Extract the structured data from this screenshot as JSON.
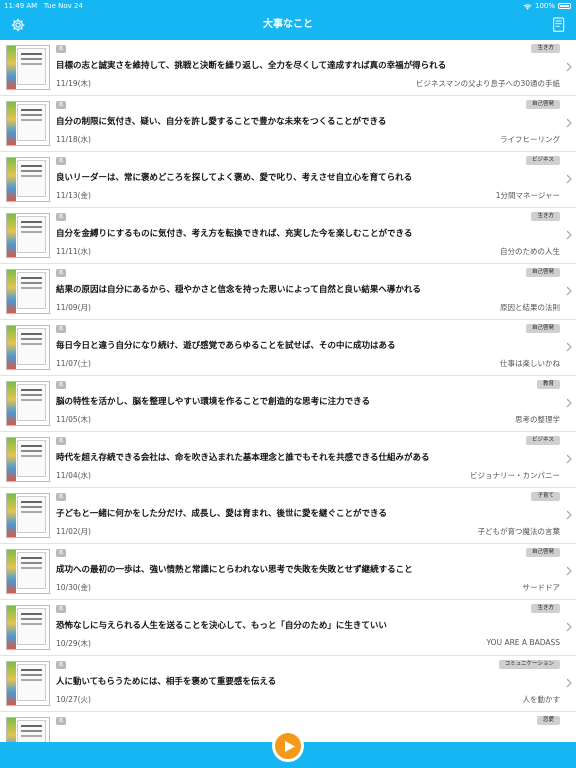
{
  "status_bar": {
    "time": "11:49 AM",
    "date": "Tue Nov 24",
    "battery": "100%"
  },
  "nav": {
    "title": "大事なこと"
  },
  "items": [
    {
      "icon": "本",
      "category": "生き方",
      "quote": "目標の志と誠実さを維持して、挑戦と決断を繰り返し、全力を尽くして達成すれば真の幸福が得られる",
      "date": "11/19(木)",
      "book": "ビジネスマンの父より息子への30通の手紙"
    },
    {
      "icon": "本",
      "category": "自己啓発",
      "quote": "自分の制限に気付き、疑い、自分を許し愛することで豊かな未来をつくることができる",
      "date": "11/18(水)",
      "book": "ライフヒーリング"
    },
    {
      "icon": "本",
      "category": "ビジネス",
      "quote": "良いリーダーは、常に褒めどころを探してよく褒め、愛で叱り、考えさせ自立心を育てられる",
      "date": "11/13(金)",
      "book": "1分間マネージャー"
    },
    {
      "icon": "本",
      "category": "生き方",
      "quote": "自分を金縛りにするものに気付き、考え方を転換できれば、充実した今を楽しむことができる",
      "date": "11/11(水)",
      "book": "自分のための人生"
    },
    {
      "icon": "本",
      "category": "自己啓発",
      "quote": "結果の原因は自分にあるから、穏やかさと信念を持った思いによって自然と良い結果へ導かれる",
      "date": "11/09(月)",
      "book": "原因と結果の法則"
    },
    {
      "icon": "本",
      "category": "自己啓発",
      "quote": "毎日今日と違う自分になり続け、遊び感覚であらゆることを試せば、その中に成功はある",
      "date": "11/07(土)",
      "book": "仕事は楽しいかね"
    },
    {
      "icon": "本",
      "category": "教育",
      "quote": "脳の特性を活かし、脳を整理しやすい環境を作ることで創造的な思考に注力できる",
      "date": "11/05(木)",
      "book": "思考の整理学"
    },
    {
      "icon": "本",
      "category": "ビジネス",
      "quote": "時代を超え存続できる会社は、命を吹き込まれた基本理念と誰でもそれを共感できる仕組みがある",
      "date": "11/04(水)",
      "book": "ビジョナリー・カンパニー"
    },
    {
      "icon": "本",
      "category": "子育て",
      "quote": "子どもと一緒に何かをした分だけ、成長し、愛は育まれ、後世に愛を継ぐことができる",
      "date": "11/02(月)",
      "book": "子どもが育つ魔法の言葉"
    },
    {
      "icon": "本",
      "category": "自己啓発",
      "quote": "成功への最初の一歩は、強い情熱と常識にとらわれない思考で失敗を失敗とせず継続すること",
      "date": "10/30(金)",
      "book": "サードドア"
    },
    {
      "icon": "本",
      "category": "生き方",
      "quote": "恐怖なしに与えられる人生を送ることを決心して、もっと「自分のため」に生きていい",
      "date": "10/29(木)",
      "book": "YOU ARE A BADASS"
    },
    {
      "icon": "本",
      "category": "コミュニケーション",
      "quote": "人に動いてもらうためには、相手を褒めて重要感を伝える",
      "date": "10/27(火)",
      "book": "人を動かす"
    },
    {
      "icon": "本",
      "category": "恋愛",
      "quote": "",
      "date": "",
      "book": ""
    }
  ],
  "colors": {
    "header": "#15b6f2",
    "play": "#f39a1a"
  }
}
